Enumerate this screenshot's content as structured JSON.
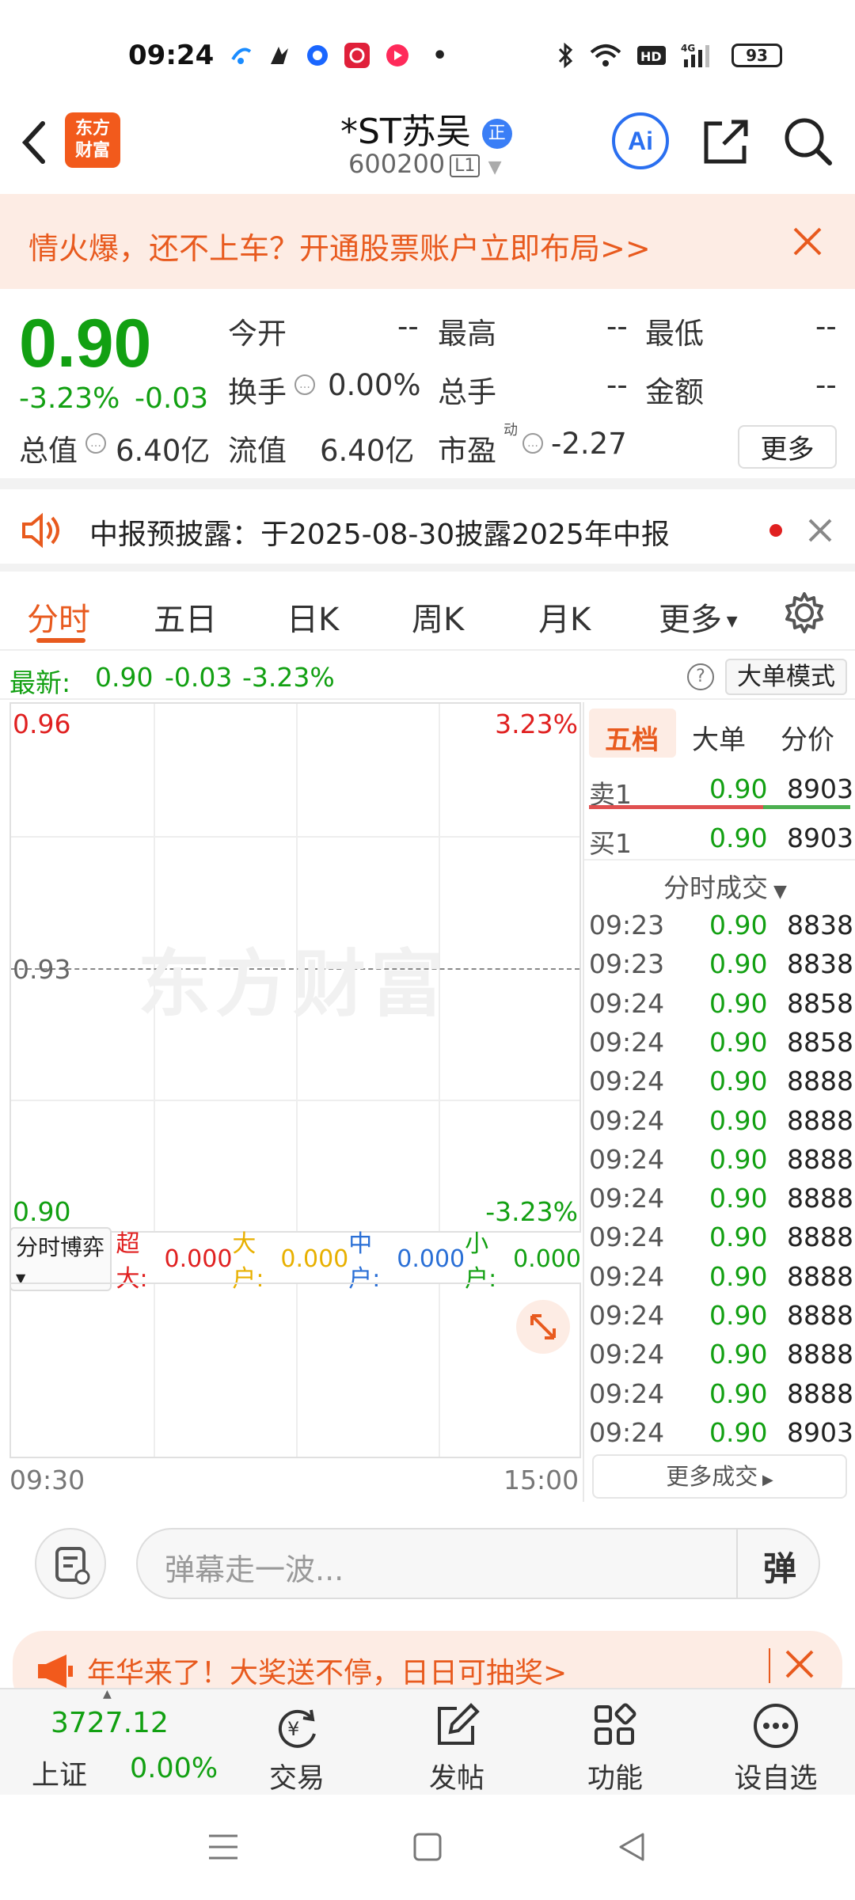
{
  "status": {
    "time": "09:24",
    "battery": "93",
    "dot": "•"
  },
  "header": {
    "logo_line1": "东方",
    "logo_line2": "财富",
    "title": "*ST苏吴",
    "badge": "正",
    "code": "600200",
    "level": "L1",
    "ai_label": "Ai"
  },
  "promo": {
    "text": "情火爆，还不上车？开通股票账户立即布局>>"
  },
  "quote": {
    "price": "0.90",
    "change_pct": "-3.23%",
    "change": "-0.03",
    "rows": [
      [
        {
          "label": "今开",
          "value": "--"
        },
        {
          "label": "最高",
          "value": "--"
        },
        {
          "label": "最低",
          "value": "--"
        }
      ],
      [
        {
          "label": "换手",
          "value": "0.00%"
        },
        {
          "label": "总手",
          "value": "--"
        },
        {
          "label": "金额",
          "value": "--"
        }
      ]
    ],
    "total_value_label": "总值",
    "total_value": "6.40亿",
    "float_value_label": "流值",
    "float_value": "6.40亿",
    "pe_label": "市盈",
    "pe_sup": "动",
    "pe_value": "-2.27",
    "more": "更多"
  },
  "notice": {
    "text": "中报预披露：于2025-08-30披露2025年中报"
  },
  "tabs": [
    "分时",
    "五日",
    "日K",
    "周K",
    "月K",
    "更多"
  ],
  "latest": {
    "label": "最新:",
    "price": "0.90",
    "change": "-0.03",
    "pct": "-3.23%",
    "mode": "大单模式"
  },
  "chart": {
    "top_price": "0.96",
    "top_pct": "3.23%",
    "mid_price": "0.93",
    "bottom_price": "0.90",
    "bottom_pct": "-3.23%",
    "watermark": "东方财富",
    "time_start": "09:30",
    "time_end": "15:00"
  },
  "indicator": {
    "selector": "分时博弈",
    "items": [
      {
        "label": "超大:",
        "value": "0.000",
        "color": "#e02020"
      },
      {
        "label": "大户:",
        "value": "0.000",
        "color": "#e8b000"
      },
      {
        "label": "中户:",
        "value": "0.000",
        "color": "#2a6fd6"
      },
      {
        "label": "小户:",
        "value": "0.000",
        "color": "#12a012"
      }
    ]
  },
  "order_book": {
    "tabs": [
      "五档",
      "大单",
      "分价"
    ],
    "sell1": {
      "label": "卖1",
      "price": "0.90",
      "vol": "8903"
    },
    "buy1": {
      "label": "买1",
      "price": "0.90",
      "vol": "8903"
    },
    "ticks_title": "分时成交",
    "ticks": [
      {
        "t": "09:23",
        "p": "0.90",
        "v": "8838"
      },
      {
        "t": "09:23",
        "p": "0.90",
        "v": "8838"
      },
      {
        "t": "09:24",
        "p": "0.90",
        "v": "8858"
      },
      {
        "t": "09:24",
        "p": "0.90",
        "v": "8858"
      },
      {
        "t": "09:24",
        "p": "0.90",
        "v": "8888"
      },
      {
        "t": "09:24",
        "p": "0.90",
        "v": "8888"
      },
      {
        "t": "09:24",
        "p": "0.90",
        "v": "8888"
      },
      {
        "t": "09:24",
        "p": "0.90",
        "v": "8888"
      },
      {
        "t": "09:24",
        "p": "0.90",
        "v": "8888"
      },
      {
        "t": "09:24",
        "p": "0.90",
        "v": "8888"
      },
      {
        "t": "09:24",
        "p": "0.90",
        "v": "8888"
      },
      {
        "t": "09:24",
        "p": "0.90",
        "v": "8888"
      },
      {
        "t": "09:24",
        "p": "0.90",
        "v": "8888"
      },
      {
        "t": "09:24",
        "p": "0.90",
        "v": "8903"
      }
    ],
    "more_trades": "更多成交"
  },
  "danmu": {
    "placeholder": "弹幕走一波...",
    "send": "弹"
  },
  "banner2": {
    "text": "年华来了！大奖送不停，日日可抽奖>"
  },
  "tabbar": {
    "index_value": "3727.12",
    "index_name": "上证",
    "index_pct": "0.00%",
    "items": [
      "交易",
      "发帖",
      "功能",
      "设自选"
    ]
  }
}
